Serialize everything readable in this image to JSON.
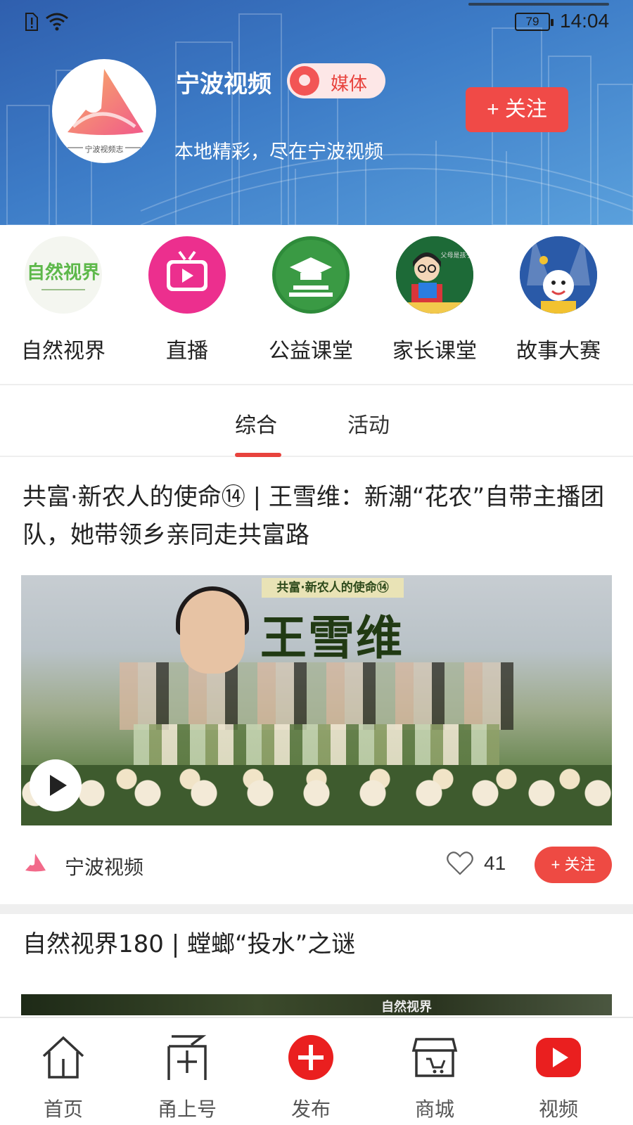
{
  "status_bar": {
    "battery": "79",
    "time": "14:04"
  },
  "channel": {
    "name": "宁波视频",
    "badge": "媒体",
    "description": "本地精彩，尽在宁波视频",
    "follow_label": "+ 关注",
    "logo_caption": "宁波视频志"
  },
  "quick_channels": [
    {
      "label": "自然视界",
      "icon": "nature-vision-icon"
    },
    {
      "label": "直播",
      "icon": "live-tv-icon"
    },
    {
      "label": "公益课堂",
      "icon": "graduation-cap-icon"
    },
    {
      "label": "家长课堂",
      "icon": "teacher-icon"
    },
    {
      "label": "故事大赛",
      "icon": "storyteller-icon"
    }
  ],
  "tabs": [
    {
      "label": "综合",
      "active": true
    },
    {
      "label": "活动",
      "active": false
    }
  ],
  "feed": [
    {
      "title": "共富·新农人的使命⑭ | 王雪维：新潮“花农”自带主播团队，她带领乡亲同走共富路",
      "thumb_tag": "共富·新农人的使命⑭",
      "thumb_headline": "王雪维",
      "source": "宁波视频",
      "likes": "41",
      "follow_label": "+ 关注"
    },
    {
      "title": "自然视界180 | 螳螂“投水”之谜",
      "thumb_tag": "自然视界"
    }
  ],
  "bottom_nav": [
    {
      "label": "首页",
      "icon": "home-icon"
    },
    {
      "label": "甬上号",
      "icon": "yongshang-icon"
    },
    {
      "label": "发布",
      "icon": "publish-plus-icon"
    },
    {
      "label": "商城",
      "icon": "store-icon"
    },
    {
      "label": "视频",
      "icon": "video-play-icon"
    }
  ],
  "colors": {
    "accent": "#e8433d",
    "header_blue": "#3d7cc7"
  }
}
